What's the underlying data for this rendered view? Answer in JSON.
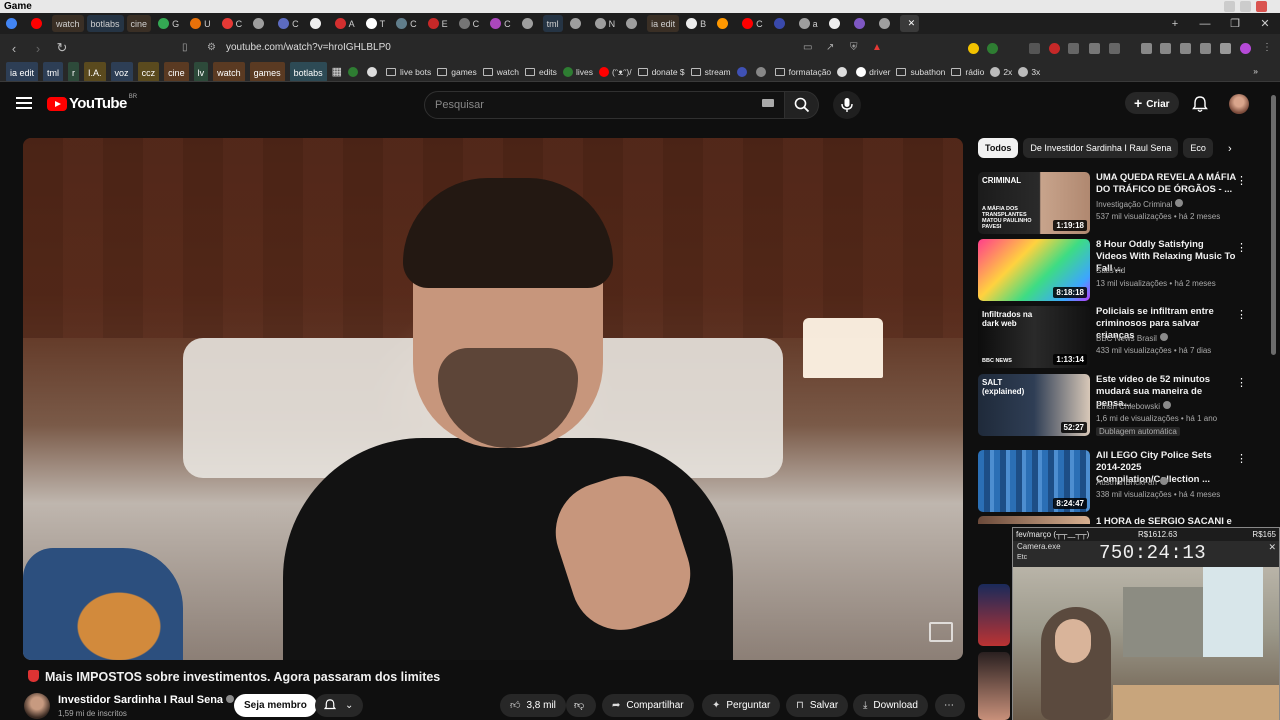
{
  "window": {
    "title": "Game"
  },
  "tabs": [
    {
      "label": "",
      "fav": "#4285f4"
    },
    {
      "label": "",
      "fav": "#ff0000"
    },
    {
      "label": "watch",
      "fav": "",
      "style": "tinted"
    },
    {
      "label": "botlabs",
      "fav": "",
      "style": "tinted2"
    },
    {
      "label": "cine",
      "fav": "",
      "style": "tinted"
    },
    {
      "label": "G",
      "fav": "#34a853"
    },
    {
      "label": "U",
      "fav": "#e8710a"
    },
    {
      "label": "C",
      "fav": "#e53935"
    },
    {
      "label": "",
      "fav": "#9e9e9e"
    },
    {
      "label": "C",
      "fav": "#5c6bc0"
    },
    {
      "label": "",
      "fav": "#eeeeee"
    },
    {
      "label": "A",
      "fav": "#d32f2f"
    },
    {
      "label": "T",
      "fav": "#ffffff"
    },
    {
      "label": "C",
      "fav": "#607d8b"
    },
    {
      "label": "E",
      "fav": "#c62828"
    },
    {
      "label": "C",
      "fav": "#757575"
    },
    {
      "label": "C",
      "fav": "#ab47bc"
    },
    {
      "label": "",
      "fav": "#9e9e9e"
    },
    {
      "label": "tml",
      "fav": "",
      "style": "tinted2"
    },
    {
      "label": "",
      "fav": "#9e9e9e"
    },
    {
      "label": "N",
      "fav": "#9e9e9e"
    },
    {
      "label": "",
      "fav": "#9e9e9e"
    },
    {
      "label": "ia edit",
      "fav": "",
      "style": "tinted"
    },
    {
      "label": "B",
      "fav": "#eeeeee"
    },
    {
      "label": "",
      "fav": "#ff9800"
    },
    {
      "label": "C",
      "fav": "#ff0000"
    },
    {
      "label": "",
      "fav": "#3949ab"
    },
    {
      "label": "a",
      "fav": "#9e9e9e"
    },
    {
      "label": "",
      "fav": "#eeeeee"
    },
    {
      "label": "",
      "fav": "#7e57c2"
    },
    {
      "label": "",
      "fav": "#9e9e9e"
    },
    {
      "label": "",
      "fav": "",
      "style": "active"
    }
  ],
  "address": {
    "url": "youtube.com/watch?v=hroIGHLBLP0"
  },
  "bookmarks": [
    {
      "label": "ia edit",
      "kind": "chip",
      "color": "#2d3e55"
    },
    {
      "label": "tml",
      "kind": "chip",
      "color": "#2d3e55"
    },
    {
      "label": "r",
      "kind": "chip",
      "color": "#2d4a3a"
    },
    {
      "label": "I.A.",
      "kind": "chip",
      "color": "#5a4a1e"
    },
    {
      "label": "voz",
      "kind": "chip",
      "color": "#2d3e55"
    },
    {
      "label": "ccz",
      "kind": "chip",
      "color": "#5a4a1e"
    },
    {
      "label": "cine",
      "kind": "chip",
      "color": "#5a3a22"
    },
    {
      "label": "lv",
      "kind": "chip",
      "color": "#2d4a3a"
    },
    {
      "label": "watch",
      "kind": "chip",
      "color": "#5a3a22"
    },
    {
      "label": "games",
      "kind": "chip",
      "color": "#5a3a22"
    },
    {
      "label": "botlabs",
      "kind": "chip",
      "color": "#2d4a55"
    },
    {
      "label": "",
      "kind": "apps"
    },
    {
      "label": "",
      "kind": "dot",
      "color": "#2e7d32"
    },
    {
      "label": "",
      "kind": "dot",
      "color": "#dddddd"
    },
    {
      "label": "live bots",
      "kind": "folder"
    },
    {
      "label": "games",
      "kind": "folder"
    },
    {
      "label": "watch",
      "kind": "folder"
    },
    {
      "label": "edits",
      "kind": "folder"
    },
    {
      "label": "lives",
      "kind": "dot",
      "color": "#2e7d32"
    },
    {
      "label": "(ᵔᴥᵔ)/",
      "kind": "dot",
      "color": "#ff0000"
    },
    {
      "label": "donate $",
      "kind": "folder"
    },
    {
      "label": "stream",
      "kind": "folder"
    },
    {
      "label": "",
      "kind": "dot",
      "color": "#3f51b5"
    },
    {
      "label": "",
      "kind": "dot",
      "color": "#888888"
    },
    {
      "label": "formatação",
      "kind": "folder"
    },
    {
      "label": "",
      "kind": "dot",
      "color": "#dddddd"
    },
    {
      "label": "driver",
      "kind": "dot",
      "color": "#ffffff"
    },
    {
      "label": "subathon",
      "kind": "folder"
    },
    {
      "label": "rádio",
      "kind": "folder"
    },
    {
      "label": "2x",
      "kind": "dot",
      "color": "#bbbbbb"
    },
    {
      "label": "3x",
      "kind": "dot",
      "color": "#bbbbbb"
    }
  ],
  "yt": {
    "logo_text": "YouTube",
    "region": "BR",
    "search_placeholder": "Pesquisar",
    "create_label": "Criar"
  },
  "video": {
    "title": "Mais IMPOSTOS sobre investimentos. Agora passaram dos limites",
    "channel": "Investidor Sardinha I Raul Sena",
    "subscribers": "1,59 mi de inscritos",
    "member_label": "Seja membro",
    "likes": "3,8 mil",
    "share_label": "Compartilhar",
    "ask_label": "Perguntar",
    "save_label": "Salvar",
    "download_label": "Download"
  },
  "sidebar": {
    "chips": [
      "Todos",
      "De Investidor Sardinha I Raul Sena",
      "Eco"
    ],
    "recs": [
      {
        "title": "UMA QUEDA REVELA A MÁFIA DO TRÁFICO DE ÓRGÃOS - ...",
        "channel": "Investigação Criminal",
        "meta": "537 mil visualizações • há 2 meses",
        "duration": "1:19:18",
        "badge": "",
        "thumb": "linear-gradient(90deg,#1b1b1b 0%,#2a2a2a 55%,#c8a48c 56%,#b08870 100%)",
        "thumb_text_top": "CRIMINAL",
        "thumb_text_bottom": "A MÁFIA DOS TRANSPLANTES MATOU PAULINHO PAVESI"
      },
      {
        "title": "8 Hour Oddly Satisfying Videos With Relaxing Music To Fall ...",
        "channel": "SatisVid",
        "meta": "13 mil visualizações • há 2 meses",
        "duration": "8:18:18",
        "badge": "",
        "thumb": "linear-gradient(135deg,#ff3d8b 0%,#ffd23f 35%,#3ddc84 60%,#3da5ff 85%,#b93dff 100%)",
        "thumb_text_top": "",
        "thumb_text_bottom": ""
      },
      {
        "title": "Policiais se infiltram entre criminosos para salvar crianças",
        "channel": "BBC News Brasil",
        "meta": "433 mil visualizações • há 7 dias",
        "duration": "1:13:14",
        "badge": "",
        "thumb": "linear-gradient(90deg,#0d0d0d 0%,#2a2a2a 50%,#111 100%)",
        "thumb_text_top": "Infiltrados na dark web",
        "thumb_text_bottom": "BBC NEWS"
      },
      {
        "title": "Este vídeo de 52 minutos mudará sua maneira de pensa...",
        "channel": "Ethan Chlebowski",
        "meta": "1,6 mi de visualizações • há 1 ano",
        "duration": "52:27",
        "badge": "Dublagem automática",
        "thumb": "linear-gradient(90deg,#1f2a3a 0%,#2f3e55 50%,#d8c8b8 100%)",
        "thumb_text_top": "SALT (explained)",
        "thumb_text_bottom": ""
      },
      {
        "title": "All LEGO City Police Sets 2014-2025 Compilation/Collection ...",
        "channel": "AustrianBrickFan",
        "meta": "338 mil visualizações • há 4 meses",
        "duration": "8:24:47",
        "badge": "",
        "thumb": "repeating-linear-gradient(90deg,#2b6fb5 0 6px,#1d4e86 6px 12px,#4d8ed0 12px 16px)",
        "thumb_text_top": "",
        "thumb_text_bottom": ""
      },
      {
        "title": "1 HORA de SERGIO SACANI e ...",
        "channel": "",
        "meta": "",
        "duration": "",
        "badge": "",
        "thumb": "linear-gradient(90deg,#6b4a3a 0%,#d8b090 100%)",
        "thumb_text_top": "",
        "thumb_text_bottom": ""
      }
    ]
  },
  "overlay": {
    "header_label": "fev/março (┬┬﹏┬┬)",
    "header_value_1": "R$1612.63",
    "header_value_2": "R$165",
    "cam_title": "Camera.exe",
    "cam_sub": "Etc",
    "timer": "750:24:13"
  }
}
